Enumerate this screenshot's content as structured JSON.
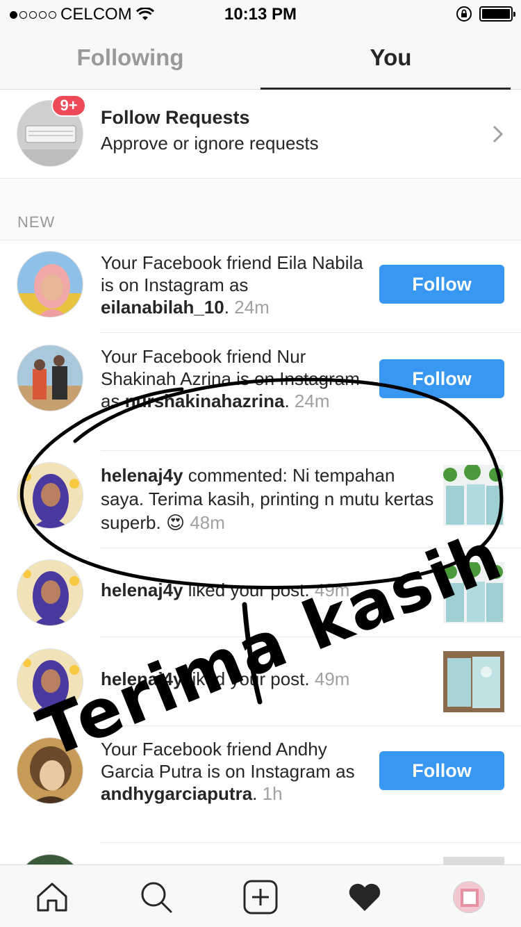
{
  "status": {
    "carrier": "CELCOM",
    "time": "10:13 PM"
  },
  "tabs": {
    "following": "Following",
    "you": "You"
  },
  "follow_requests": {
    "badge": "9+",
    "title": "Follow Requests",
    "subtitle": "Approve or ignore requests"
  },
  "section": {
    "label": "NEW"
  },
  "notifications": [
    {
      "prefix": "Your Facebook friend Eila Nabila is on Instagram as",
      "username": "eilanabilah_10",
      "suffix": ".",
      "time": "24m",
      "button": "Follow"
    },
    {
      "prefix": "Your Facebook friend Nur Shakinah Azrina is on Instagram as",
      "username": "nurshakinahazrina",
      "suffix": ".",
      "time": "24m",
      "button": "Follow"
    },
    {
      "username": "helenaj4y",
      "message": "commented: Ni tempahan saya. Terima kasih, printing n mutu kertas superb.",
      "emoji": "😍",
      "time": "48m"
    },
    {
      "username": "helenaj4y",
      "message": "liked your post.",
      "time": "49m"
    },
    {
      "username": "helenaj4y",
      "message": "liked your post.",
      "time": "49m"
    },
    {
      "prefix": "Your Facebook friend Andhy Garcia Putra is on Instagram as",
      "username": "andhygarciaputra",
      "suffix": ".",
      "time": "1h",
      "button": "Follow"
    }
  ],
  "overlay_text": "Terima kasih",
  "colors": {
    "accent": "#3897f0",
    "badge": "#ed4956",
    "muted": "#a0a0a0"
  },
  "nav": [
    "home-icon",
    "search-icon",
    "add-icon",
    "heart-icon",
    "profile-icon"
  ]
}
